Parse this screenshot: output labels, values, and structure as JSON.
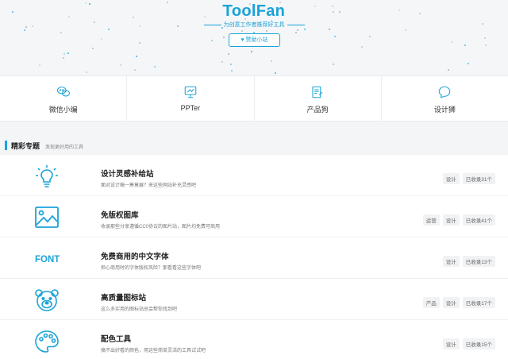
{
  "brand": {
    "title": "ToolFan",
    "tagline": "为创意工作者推荐好工具",
    "sponsor_label": "♥ 赞助小站"
  },
  "nav": {
    "items": [
      {
        "label": "微信小编",
        "icon": "wechat-icon"
      },
      {
        "label": "PPTer",
        "icon": "presentation-icon"
      },
      {
        "label": "产品狗",
        "icon": "document-edit-icon"
      },
      {
        "label": "设计狮",
        "icon": "chat-bubble-icon"
      }
    ]
  },
  "section": {
    "title": "精彩专题",
    "subtitle": "发现更好用的工具"
  },
  "topics": [
    {
      "title": "设计灵感补给站",
      "desc": "面对设计稿一筹莫展？来这些网站补充灵感吧",
      "icon": "lightbulb-icon",
      "tags": [
        "设计"
      ],
      "count": "已收录31个"
    },
    {
      "title": "免版权图库",
      "desc": "收录那些分享遵循CC0协议的图片站，图片均免费可商用",
      "icon": "image-icon",
      "tags": [
        "运营",
        "设计"
      ],
      "count": "已收录41个"
    },
    {
      "title": "免费商用的中文字体",
      "desc": "担心商用时的字体版权风险？那看看这些字体吧",
      "icon": "font-icon",
      "icon_text": "FONT",
      "tags": [
        "设计"
      ],
      "count": "已收录13个"
    },
    {
      "title": "高质量图标站",
      "desc": "这么多实用的图标站总会帮你找到吧",
      "icon": "bear-icon",
      "tags": [
        "产品",
        "设计"
      ],
      "count": "已收录17个"
    },
    {
      "title": "配色工具",
      "desc": "搞不出好看的颜色，用这些简单灵活的工具试试吧",
      "icon": "palette-icon",
      "tags": [
        "设计"
      ],
      "count": "已收录15个"
    }
  ],
  "colors": {
    "accent": "#1aa3d9",
    "background": "#f3f5f7"
  }
}
